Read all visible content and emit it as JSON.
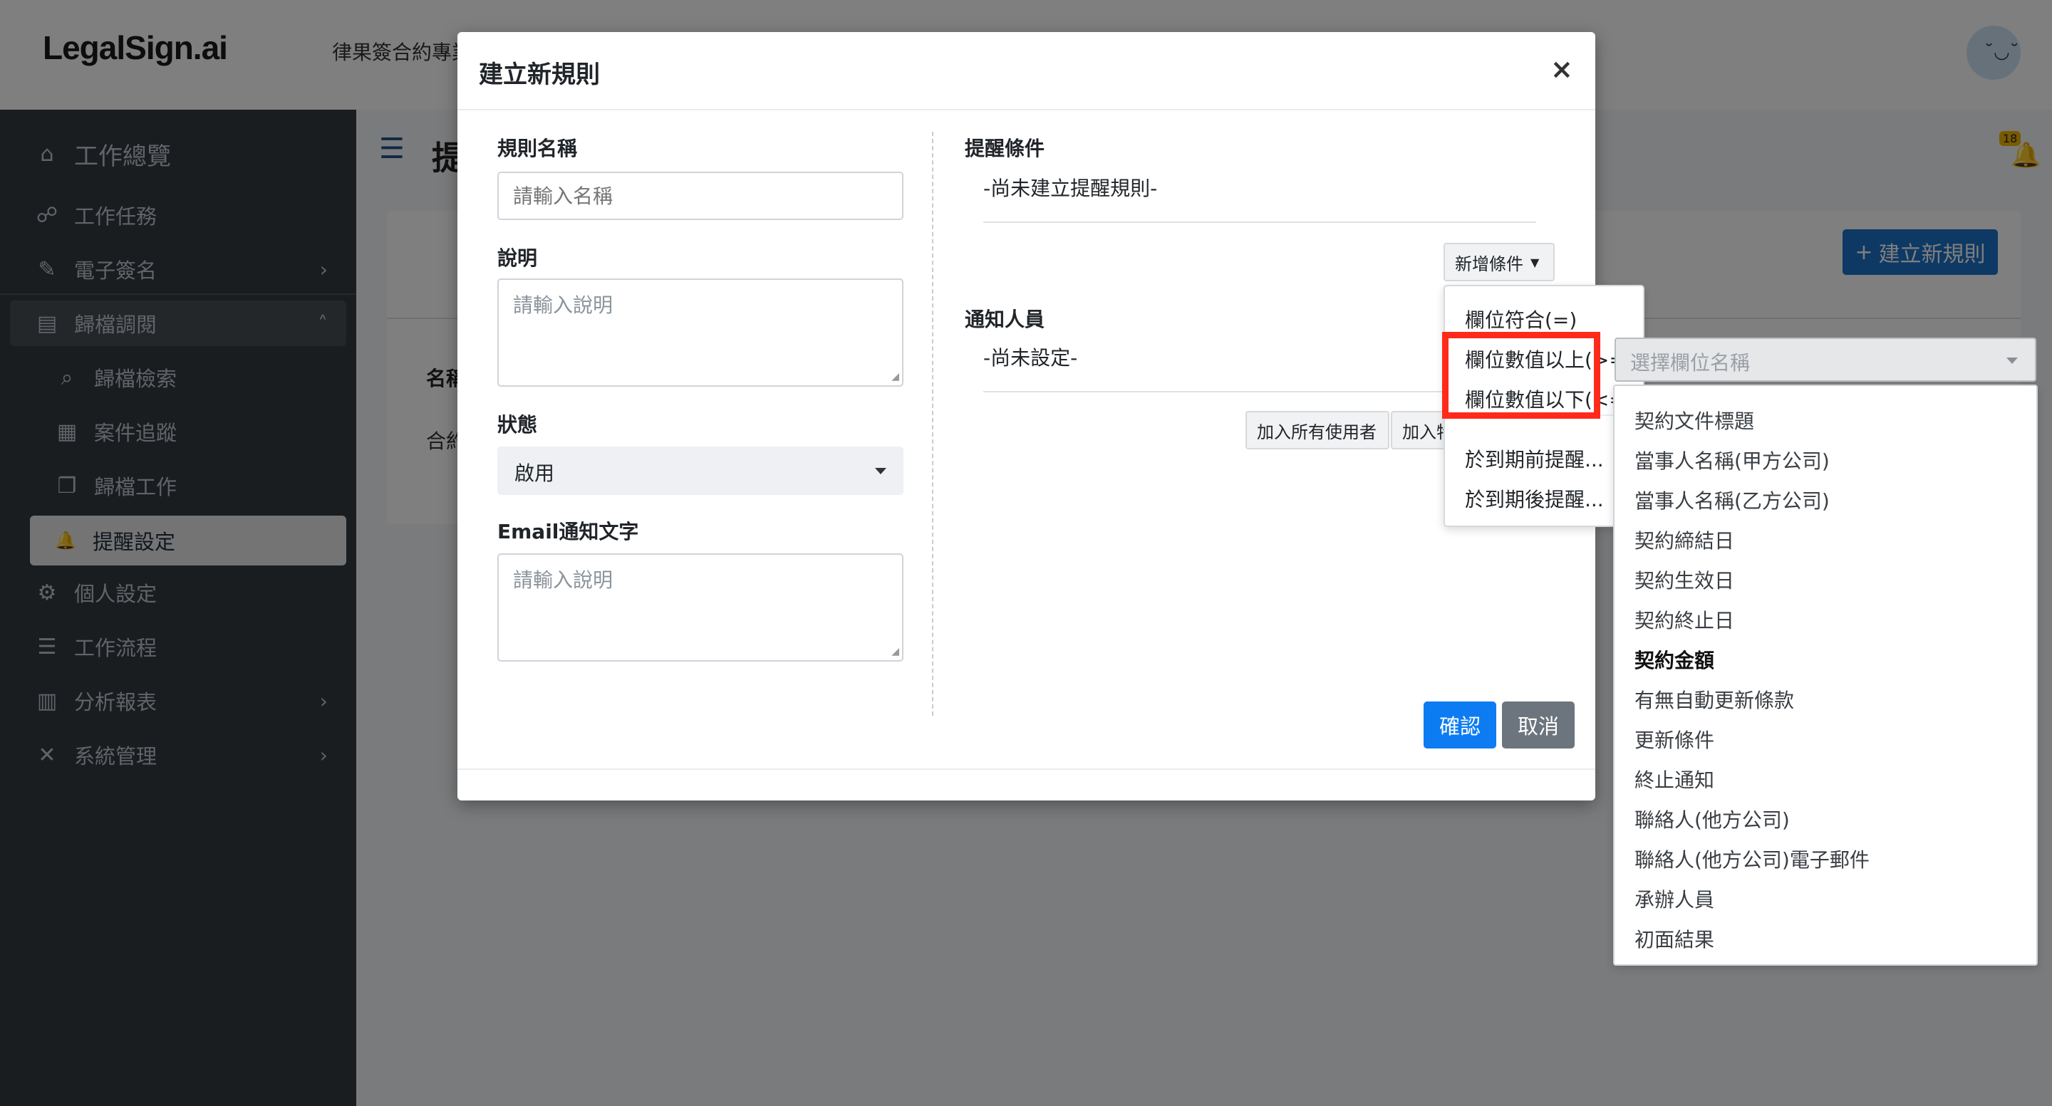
{
  "topbar": {
    "logo": "LegalSign.ai",
    "firm": "律果簽合約專業"
  },
  "sidebar": {
    "items": [
      {
        "label": "工作總覽",
        "icon": "⌂"
      },
      {
        "label": "工作任務",
        "icon": "☍"
      },
      {
        "label": "電子簽名",
        "icon": "✎",
        "arrow": "›"
      },
      {
        "label": "歸檔調閱",
        "icon": "▤",
        "arrow": "˄"
      },
      {
        "label": "歸檔檢索",
        "icon": "⌕"
      },
      {
        "label": "案件追蹤",
        "icon": "▦"
      },
      {
        "label": "歸檔工作",
        "icon": "❐"
      },
      {
        "label": "提醒設定",
        "icon": "🔔"
      },
      {
        "label": "個人設定",
        "icon": "⚙"
      },
      {
        "label": "工作流程",
        "icon": "☰"
      },
      {
        "label": "分析報表",
        "icon": "▥",
        "arrow": "›"
      },
      {
        "label": "系統管理",
        "icon": "✕",
        "arrow": "›"
      }
    ]
  },
  "page": {
    "title": "提",
    "bell_badge": "18",
    "new_rule_button": "建立新規則",
    "column_name": "名稱",
    "row_contract": "合約"
  },
  "modal": {
    "title": "建立新規則",
    "close": "×",
    "rule_name_label": "規則名稱",
    "rule_name_placeholder": "請輸入名稱",
    "description_label": "說明",
    "description_placeholder": "請輸入說明",
    "status_label": "狀態",
    "status_value": "啟用",
    "email_label": "Email通知文字",
    "email_placeholder": "請輸入說明",
    "condition_label": "提醒條件",
    "condition_empty": "-尚未建立提醒規則-",
    "add_condition_button": "新增條件",
    "notify_label": "通知人員",
    "notify_empty": "-尚未設定-",
    "add_all_users_button": "加入所有使用者",
    "add_specific_button": "加入特",
    "confirm_button": "確認",
    "cancel_button": "取消"
  },
  "condition_menu": {
    "items": [
      "欄位符合(=)",
      "欄位數值以上(>=)",
      "欄位數值以下(<=)",
      "於到期前提醒...",
      "於到期後提醒..."
    ]
  },
  "field_select": {
    "placeholder": "選擇欄位名稱",
    "options": [
      "契約文件標題",
      "當事人名稱(甲方公司)",
      "當事人名稱(乙方公司)",
      "契約締結日",
      "契約生效日",
      "契約終止日",
      "契約金額",
      "有無自動更新條款",
      "更新條件",
      "終止通知",
      "聯絡人(他方公司)",
      "聯絡人(他方公司)電子郵件",
      "承辦人員",
      "初面結果"
    ],
    "highlighted": "契約金額"
  },
  "colors": {
    "sidebar_bg": "#343a40",
    "primary": "#0d7bf2",
    "secondary": "#6c757d",
    "highlight": "#ff2a1a",
    "brand_button": "#1a73c9"
  }
}
